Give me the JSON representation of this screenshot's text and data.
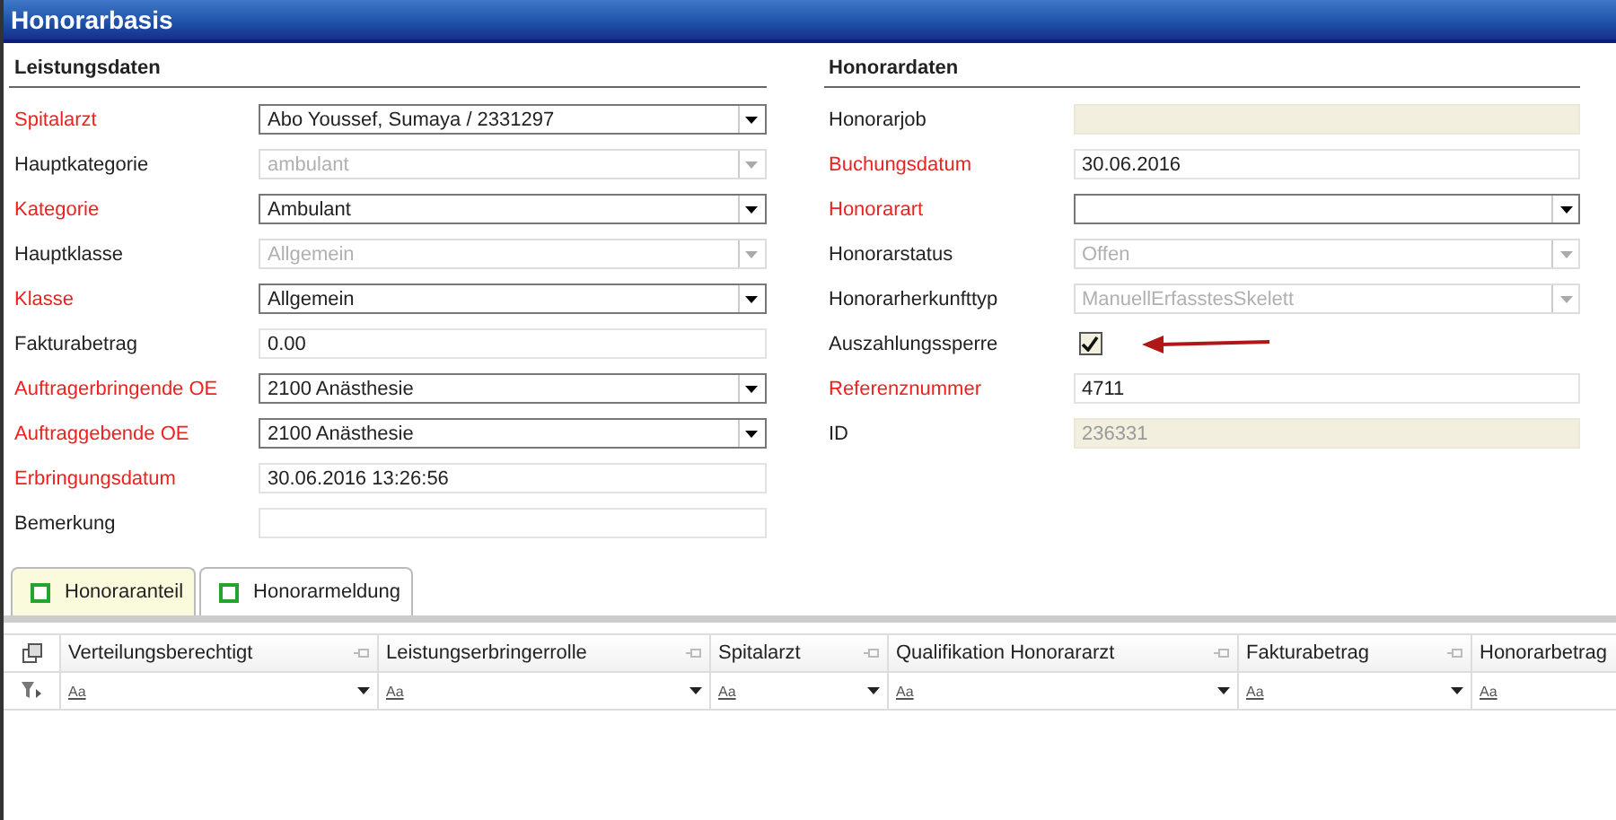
{
  "window": {
    "title": "Honorarbasis"
  },
  "sections": [
    {
      "title": "Leistungsdaten",
      "fields": [
        {
          "label": "Spitalarzt",
          "kind": "dropdown",
          "required": true,
          "disabled": false,
          "value": "Abo Youssef, Sumaya / 2331297"
        },
        {
          "label": "Hauptkategorie",
          "kind": "dropdown",
          "required": false,
          "disabled": true,
          "value": "ambulant"
        },
        {
          "label": "Kategorie",
          "kind": "dropdown",
          "required": true,
          "disabled": false,
          "value": "Ambulant"
        },
        {
          "label": "Hauptklasse",
          "kind": "dropdown",
          "required": false,
          "disabled": true,
          "value": "Allgemein"
        },
        {
          "label": "Klasse",
          "kind": "dropdown",
          "required": true,
          "disabled": false,
          "value": "Allgemein"
        },
        {
          "label": "Fakturabetrag",
          "kind": "text",
          "required": false,
          "readonly": false,
          "value": "0.00"
        },
        {
          "label": "Auftragerbringende OE",
          "kind": "dropdown",
          "required": true,
          "disabled": false,
          "value": "2100 Anästhesie"
        },
        {
          "label": "Auftraggebende OE",
          "kind": "dropdown",
          "required": true,
          "disabled": false,
          "value": "2100 Anästhesie"
        },
        {
          "label": "Erbringungsdatum",
          "kind": "text",
          "required": true,
          "readonly": false,
          "value": "30.06.2016 13:26:56"
        },
        {
          "label": "Bemerkung",
          "kind": "text",
          "required": false,
          "readonly": false
        }
      ]
    },
    {
      "title": "Honorardaten",
      "fields": [
        {
          "label": "Honorarjob",
          "kind": "text",
          "required": false,
          "readonly": true
        },
        {
          "label": "Buchungsdatum",
          "kind": "text",
          "required": true,
          "readonly": false,
          "value": "30.06.2016"
        },
        {
          "label": "Honorarart",
          "kind": "dropdown",
          "required": true,
          "disabled": false
        },
        {
          "label": "Honorarstatus",
          "kind": "dropdown",
          "required": false,
          "disabled": true,
          "value": "Offen"
        },
        {
          "label": "Honorarherkunfttyp",
          "kind": "dropdown",
          "required": false,
          "disabled": true,
          "value": "ManuellErfasstesSkelett"
        },
        {
          "label": "Auszahlungssperre",
          "kind": "checkbox",
          "required": false,
          "checked": true
        },
        {
          "label": "Referenznummer",
          "kind": "text",
          "required": true,
          "readonly": false,
          "value": "4711"
        },
        {
          "label": "ID",
          "kind": "text",
          "required": false,
          "readonly": true,
          "value": "236331"
        }
      ]
    }
  ],
  "tabs": [
    {
      "label": "Honoraranteil",
      "selected": true
    },
    {
      "label": "Honorarmeldung",
      "selected": false
    }
  ],
  "grid": {
    "columns": [
      {
        "header": "Verteilungsberechtigt",
        "filter": "Aa",
        "dropdown": true
      },
      {
        "header": "Leistungserbringerrolle",
        "filter": "Aa",
        "dropdown": true
      },
      {
        "header": "Spitalarzt",
        "filter": "Aa",
        "dropdown": true
      },
      {
        "header": "Qualifikation Honorararzt",
        "filter": "Aa",
        "dropdown": true
      },
      {
        "header": "Fakturabetrag",
        "filter": "Aa",
        "dropdown": true
      },
      {
        "header": "Honorarbetrag",
        "filter": "Aa",
        "dropdown": false
      }
    ]
  }
}
